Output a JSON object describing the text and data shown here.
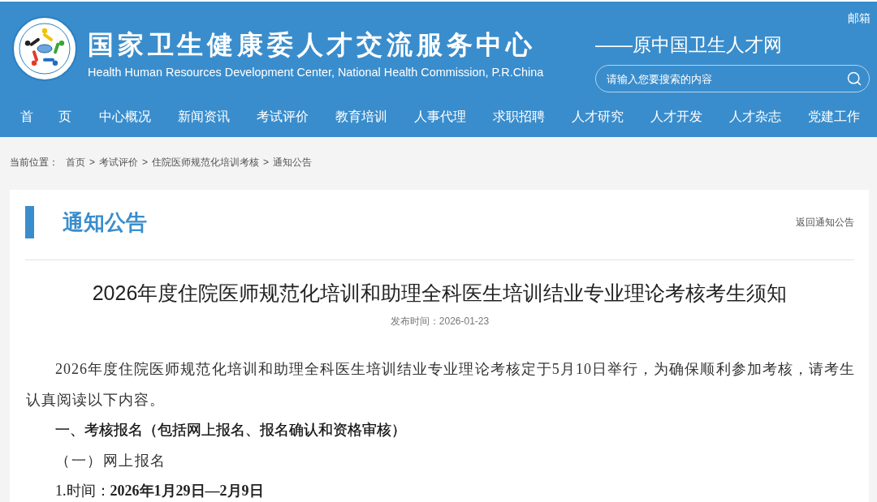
{
  "header": {
    "title": "国家卫生健康委人才交流服务中心",
    "subtitle": "Health Human Resources Development Center, National Health Commission, P.R.China",
    "mail_link": "邮箱",
    "tagline": "——原中国卫生人才网",
    "search": {
      "placeholder": "请输入您要搜索的内容"
    }
  },
  "nav": [
    {
      "label": "首 页"
    },
    {
      "label": "中心概况"
    },
    {
      "label": "新闻资讯"
    },
    {
      "label": "考试评价"
    },
    {
      "label": "教育培训"
    },
    {
      "label": "人事代理"
    },
    {
      "label": "求职招聘"
    },
    {
      "label": "人才研究"
    },
    {
      "label": "人才开发"
    },
    {
      "label": "人才杂志"
    },
    {
      "label": "党建工作"
    }
  ],
  "breadcrumb": {
    "label": "当前位置：",
    "items": [
      {
        "text": "首页",
        "separator": ">"
      },
      {
        "text": "考试评价",
        "separator": ">"
      },
      {
        "text": "住院医师规范化培训考核",
        "separator": ">"
      },
      {
        "text": "通知公告"
      }
    ]
  },
  "section": {
    "title": "通知公告",
    "back_link": "返回通知公告"
  },
  "article": {
    "title": "2026年度住院医师规范化培训和助理全科医生培训结业专业理论考核考生须知",
    "meta": "发布时间：2026-01-23",
    "body": [
      {
        "kind": "paragraph",
        "text": "2026年度住院医师规范化培训和助理全科医生培训结业专业理论考核定于5月10日举行，为确保顺利参加考核，请考生认真阅读以下内容。"
      },
      {
        "kind": "heading",
        "text": "一、考核报名（包括网上报名、报名确认和资格审核）"
      },
      {
        "kind": "subheading",
        "text": "（一）网上报名"
      },
      {
        "kind": "item",
        "text": "1.时间：**2026年1月29日—2月9日**"
      }
    ]
  }
}
